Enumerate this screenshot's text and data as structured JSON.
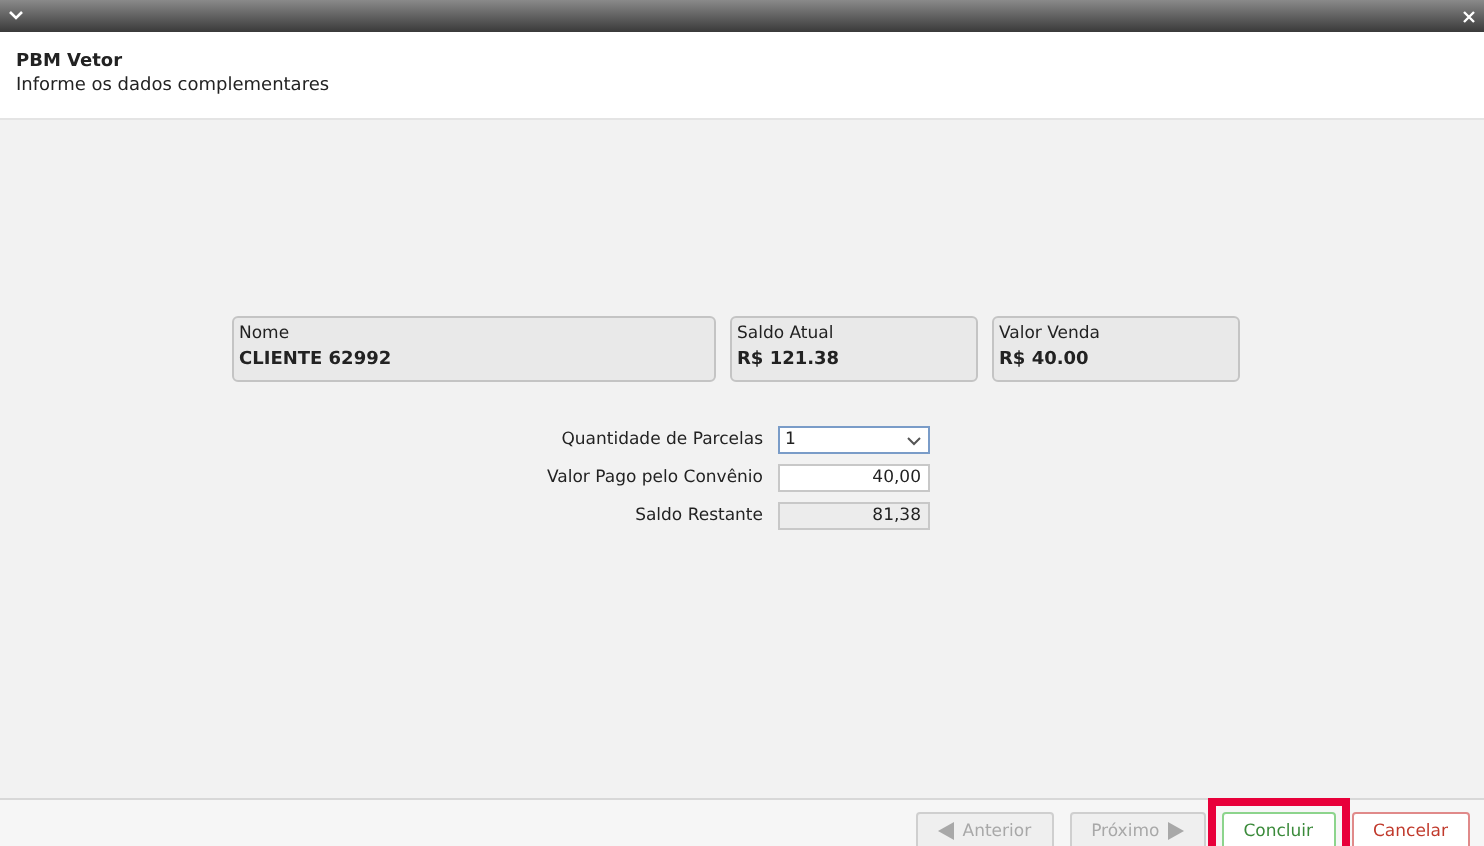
{
  "window": {
    "title": "PBM Vetor",
    "subtitle": "Informe os dados complementares"
  },
  "info_cards": [
    {
      "label": "Nome",
      "value": "CLIENTE 62992",
      "wide": true
    },
    {
      "label": "Saldo Atual",
      "value": "R$ 121.38",
      "wide": false
    },
    {
      "label": "Valor Venda",
      "value": "R$ 40.00",
      "wide": false
    }
  ],
  "form": [
    {
      "kind": "select",
      "label": "Quantidade de Parcelas",
      "value": "1"
    },
    {
      "kind": "input",
      "label": "Valor Pago pelo Convênio",
      "value": "40,00"
    },
    {
      "kind": "readonly",
      "label": "Saldo Restante",
      "value": "81,38"
    }
  ],
  "buttons": [
    {
      "label": "Anterior",
      "kind": "prev",
      "disabled": true,
      "highlighted": false
    },
    {
      "label": "Próximo",
      "kind": "next",
      "disabled": true,
      "highlighted": false
    },
    {
      "label": "Concluir",
      "kind": "ok",
      "disabled": false,
      "highlighted": true
    },
    {
      "label": "Cancelar",
      "kind": "cancel",
      "disabled": false,
      "highlighted": false
    }
  ]
}
